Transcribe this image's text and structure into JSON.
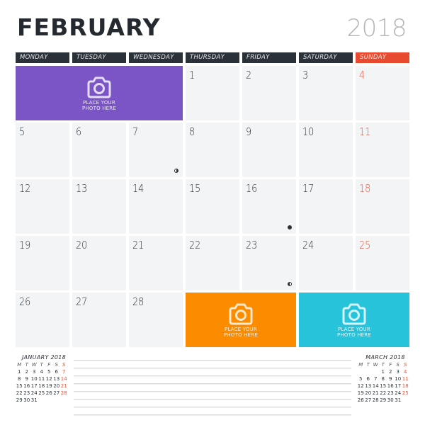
{
  "header": {
    "month": "FEBRUARY",
    "year": "2018"
  },
  "weekdays": [
    "MONDAY",
    "TUESDAY",
    "WEDNESDAY",
    "THURSDAY",
    "FRIDAY",
    "SATURDAY",
    "SUNDAY"
  ],
  "colors": {
    "header_dark": "#2a3138",
    "sunday_red": "#e84a2f",
    "photo_purple": "#7b55c6",
    "photo_orange": "#fb8c00",
    "photo_cyan": "#26c3da",
    "cell_bg": "#f3f4f6"
  },
  "photo_placeholders": [
    {
      "id": "purple",
      "text_line1": "PLACE YOUR",
      "text_line2": "PHOTO HERE",
      "icon": "camera-icon"
    },
    {
      "id": "orange",
      "text_line1": "PLACE YOUR",
      "text_line2": "PHOTO HERE",
      "icon": "camera-icon"
    },
    {
      "id": "cyan",
      "text_line1": "PLACE YOUR",
      "text_line2": "PHOTO HERE",
      "icon": "camera-icon"
    }
  ],
  "days": [
    {
      "n": "1",
      "moon": null
    },
    {
      "n": "2",
      "moon": null
    },
    {
      "n": "3",
      "moon": null
    },
    {
      "n": "4",
      "moon": null
    },
    {
      "n": "5",
      "moon": null
    },
    {
      "n": "6",
      "moon": null
    },
    {
      "n": "7",
      "moon": "last-quarter"
    },
    {
      "n": "8",
      "moon": null
    },
    {
      "n": "9",
      "moon": null
    },
    {
      "n": "10",
      "moon": null
    },
    {
      "n": "11",
      "moon": null
    },
    {
      "n": "12",
      "moon": null
    },
    {
      "n": "13",
      "moon": null
    },
    {
      "n": "14",
      "moon": null
    },
    {
      "n": "15",
      "moon": null
    },
    {
      "n": "16",
      "moon": "new-moon"
    },
    {
      "n": "17",
      "moon": null
    },
    {
      "n": "18",
      "moon": null
    },
    {
      "n": "19",
      "moon": null
    },
    {
      "n": "20",
      "moon": null
    },
    {
      "n": "21",
      "moon": null
    },
    {
      "n": "22",
      "moon": null
    },
    {
      "n": "23",
      "moon": "first-quarter"
    },
    {
      "n": "24",
      "moon": null
    },
    {
      "n": "25",
      "moon": null
    },
    {
      "n": "26",
      "moon": null
    },
    {
      "n": "27",
      "moon": null
    },
    {
      "n": "28",
      "moon": null
    }
  ],
  "mini_calendars": {
    "january": {
      "title": "JANUARY 2018",
      "dow": [
        "M",
        "T",
        "W",
        "T",
        "F",
        "S",
        "S"
      ],
      "lead_blanks": 0,
      "days": 31
    },
    "march": {
      "title": "MARCH 2018",
      "dow": [
        "M",
        "T",
        "W",
        "T",
        "F",
        "S",
        "S"
      ],
      "lead_blanks": 3,
      "days": 31
    }
  },
  "notes": {
    "line_count": 8
  }
}
